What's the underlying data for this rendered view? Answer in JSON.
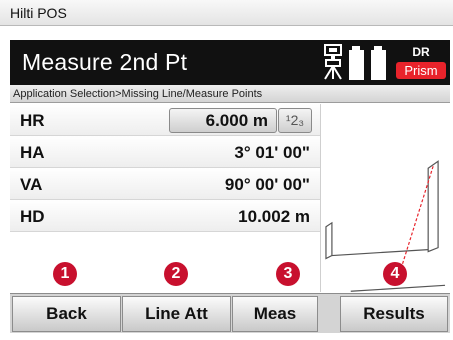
{
  "os_bar": {
    "title": "Hilti POS"
  },
  "header": {
    "title": "Measure 2nd Pt",
    "icons": [
      "tripod-icon",
      "battery-icon"
    ],
    "mode": "DR",
    "target": "Prism",
    "target_color": "#e8232b"
  },
  "breadcrumb": "Application Selection>Missing Line/Measure Points",
  "measurements": [
    {
      "label": "HR",
      "value": "6.000 m",
      "unit_toggle": "¹2₃"
    },
    {
      "label": "HA",
      "value": "3° 01' 00\""
    },
    {
      "label": "VA",
      "value": "90° 00' 00\""
    },
    {
      "label": "HD",
      "value": "10.002 m"
    }
  ],
  "callouts": [
    "1",
    "2",
    "3",
    "4"
  ],
  "softkeys": [
    "Back",
    "Line Att",
    "Meas",
    "Results"
  ],
  "colors": {
    "header_bg": "#111111",
    "callout": "#c8102e"
  }
}
